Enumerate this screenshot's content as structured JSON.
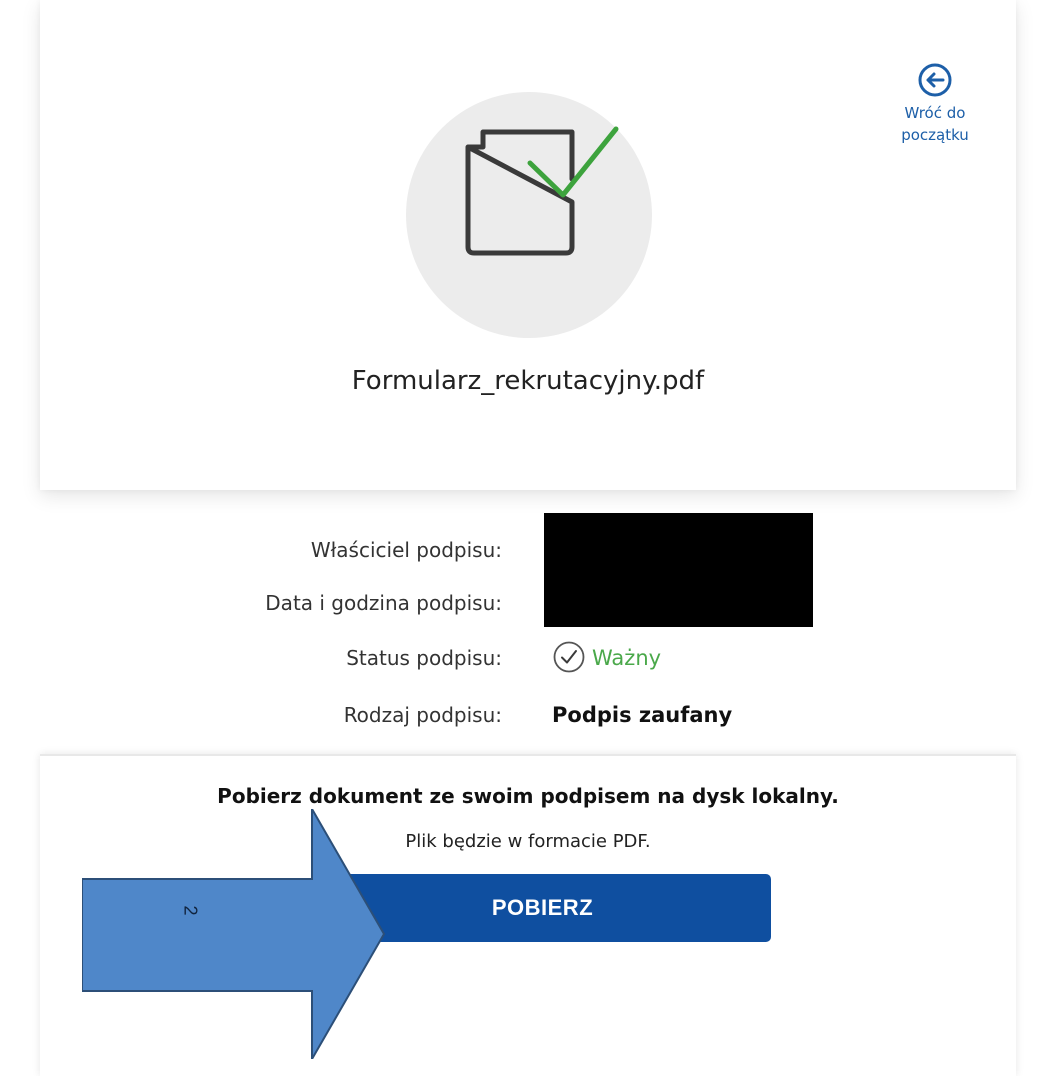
{
  "document": {
    "filename": "Formularz_rekrutacyjny.pdf",
    "icon": "signed-document-icon"
  },
  "back": {
    "label": "Wróć do początku",
    "icon": "arrow-left-circle-icon"
  },
  "signature": {
    "owner_label": "Właściciel podpisu:",
    "datetime_label": "Data i godzina podpisu:",
    "status_label": "Status podpisu:",
    "status_value": "Ważny",
    "type_label": "Rodzaj podpisu:",
    "type_value": "Podpis zaufany"
  },
  "download": {
    "title": "Pobierz dokument ze swoim podpisem na dysk lokalny.",
    "subtitle": "Plik będzie w formacie PDF.",
    "button_label": "POBIERZ"
  },
  "annotation": {
    "step_number": "2"
  },
  "colors": {
    "link_blue": "#1d5fa8",
    "button_blue": "#0f4fa0",
    "check_green": "#4aa84a",
    "annotation_arrow": "#4f87c9"
  }
}
